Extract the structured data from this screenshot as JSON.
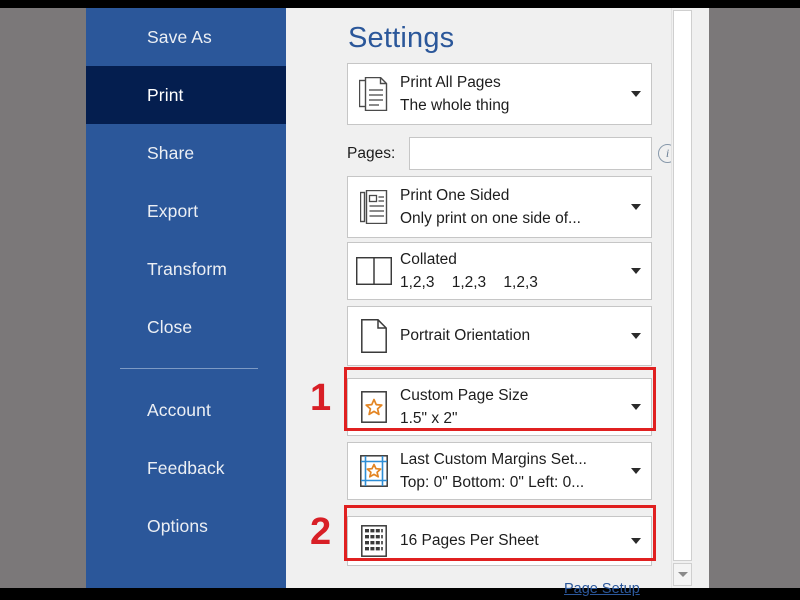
{
  "sidebar": {
    "items": [
      {
        "label": "Save As",
        "selected": false
      },
      {
        "label": "Print",
        "selected": true
      },
      {
        "label": "Share",
        "selected": false
      },
      {
        "label": "Export",
        "selected": false
      },
      {
        "label": "Transform",
        "selected": false
      },
      {
        "label": "Close",
        "selected": false
      }
    ],
    "items_bottom": [
      {
        "label": "Account"
      },
      {
        "label": "Feedback"
      },
      {
        "label": "Options"
      }
    ],
    "background_color": "#2b579a",
    "selected_color": "#041e4f"
  },
  "pane": {
    "title": "Settings",
    "title_color": "#2b579a",
    "page_setup_link": "Page Setup",
    "rows": [
      {
        "icon": "print-range-icon",
        "line1": "Print All Pages",
        "line2": "The whole thing",
        "caret": "chevron-down-icon"
      },
      {
        "icon": "print-one-sided-icon",
        "line1": "Print One Sided",
        "line2": "Only print on one side of...",
        "caret": "chevron-down-icon"
      },
      {
        "icon": "collated-icon",
        "line1": "Collated",
        "line2": "1,2,3    1,2,3    1,2,3",
        "caret": "chevron-down-icon"
      },
      {
        "icon": "portrait-page-icon",
        "line1": "Portrait Orientation",
        "line2": "",
        "caret": "chevron-down-icon"
      },
      {
        "icon": "custom-page-size-icon",
        "line1": "Custom Page Size",
        "line2": "1.5\" x 2\"",
        "caret": "chevron-down-icon"
      },
      {
        "icon": "custom-margins-icon",
        "line1": "Last Custom Margins Set...",
        "line2": "Top: 0\" Bottom: 0\" Left: 0...",
        "caret": "chevron-down-icon"
      },
      {
        "icon": "pages-per-sheet-icon",
        "line1": "16 Pages Per Sheet",
        "line2": "",
        "caret": "chevron-down-icon"
      }
    ],
    "pages_field": {
      "label": "Pages:",
      "value": "",
      "placeholder": "",
      "info_icon": "info-icon",
      "info_glyph": "i"
    }
  },
  "annotations": {
    "highlight_color": "#e02020",
    "marker_color": "#d81f26",
    "markers": [
      {
        "number": "1"
      },
      {
        "number": "2"
      }
    ]
  },
  "scrollbar": {
    "down_arrow": "scroll-down-icon"
  }
}
